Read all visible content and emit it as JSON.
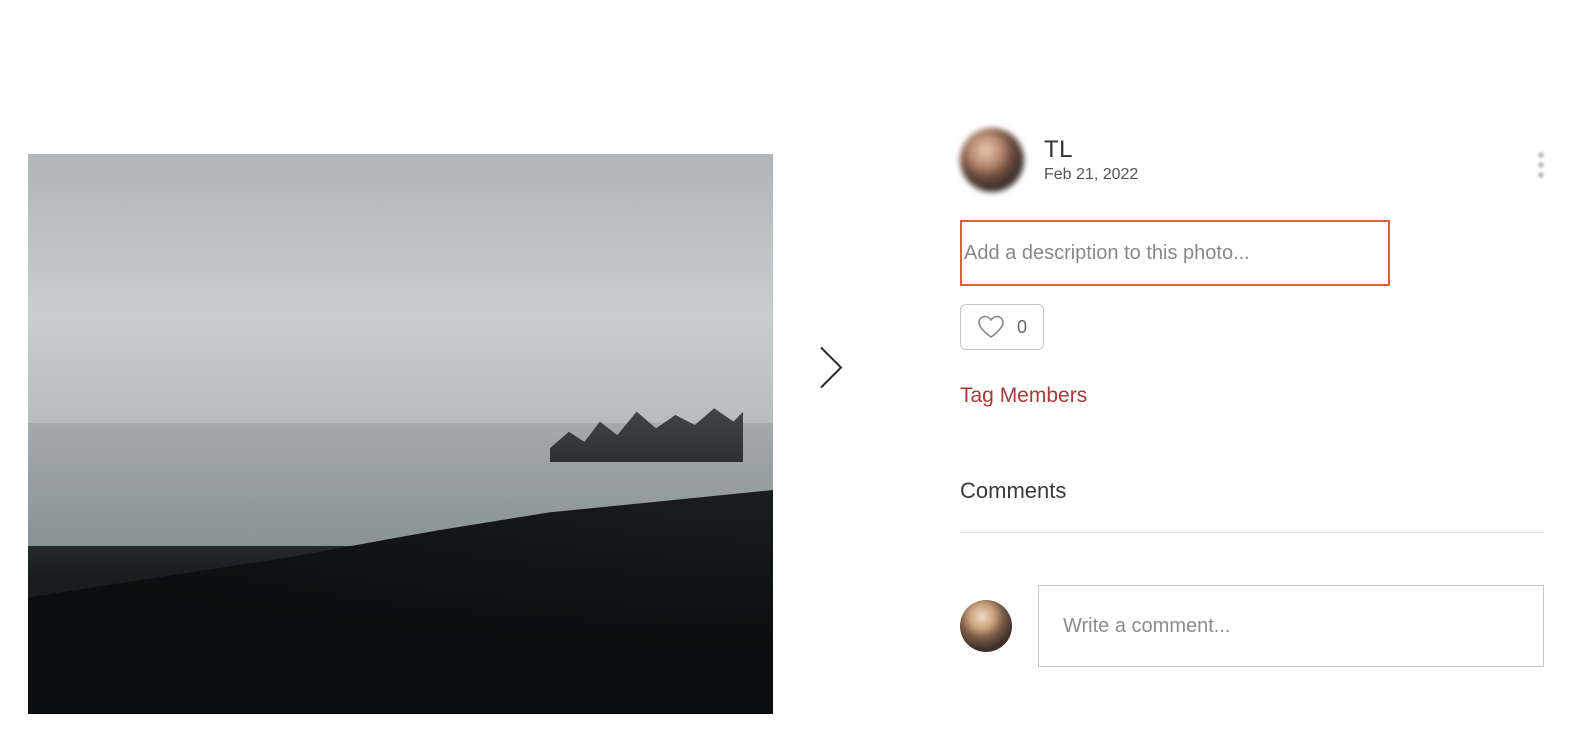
{
  "post": {
    "author_name": "TL",
    "date": "Feb 21, 2022",
    "description_placeholder": "Add a description to this photo...",
    "like_count": "0",
    "tag_members_label": "Tag Members"
  },
  "comments": {
    "heading": "Comments",
    "input_placeholder": "Write a comment..."
  }
}
